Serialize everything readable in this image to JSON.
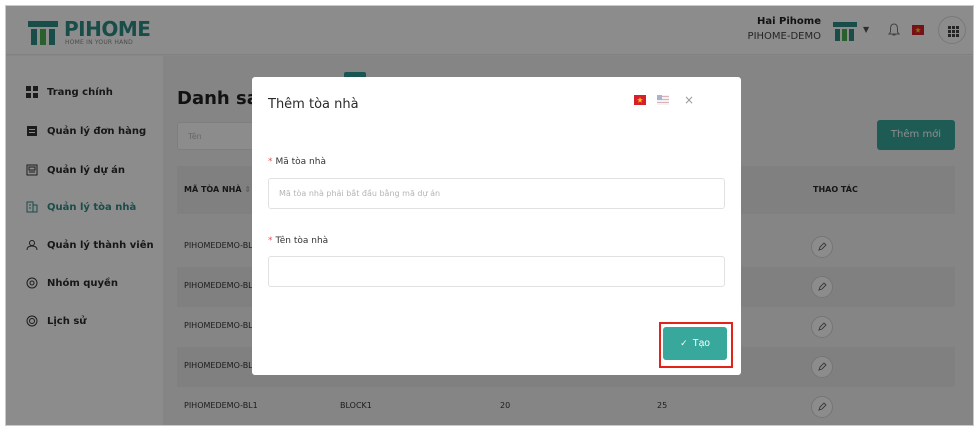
{
  "brand": {
    "name": "PIHOME",
    "tagline": "HOME IN YOUR HAND",
    "color": "#2e8c85"
  },
  "header": {
    "user_name": "Hai Pihome",
    "organization": "PIHOME-DEMO"
  },
  "sidebar": {
    "items": [
      {
        "label": "Trang chính",
        "icon": "dashboard-icon"
      },
      {
        "label": "Quản lý đơn hàng",
        "icon": "orders-icon"
      },
      {
        "label": "Quản lý dự án",
        "icon": "project-icon"
      },
      {
        "label": "Quản lý tòa nhà",
        "icon": "building-icon",
        "active": true
      },
      {
        "label": "Quản lý thành viên",
        "icon": "user-icon"
      },
      {
        "label": "Nhóm quyền",
        "icon": "permission-group-icon"
      },
      {
        "label": "Lịch sử",
        "icon": "history-icon"
      }
    ]
  },
  "page": {
    "title": "Danh sác",
    "search_placeholder": "Tên",
    "add_button": "Thêm mới"
  },
  "table": {
    "columns": {
      "code": "MÃ TÒA NHÀ",
      "actions": "THAO TÁC"
    },
    "rows": [
      {
        "code": "PIHOMEDEMO-BL",
        "name": "",
        "floors": "",
        "units": ""
      },
      {
        "code": "PIHOMEDEMO-BL",
        "name": "",
        "floors": "",
        "units": ""
      },
      {
        "code": "PIHOMEDEMO-BL",
        "name": "",
        "floors": "",
        "units": ""
      },
      {
        "code": "PIHOMEDEMO-BL",
        "name": "",
        "floors": "",
        "units": ""
      },
      {
        "code": "PIHOMEDEMO-BL1",
        "name": "BLOCK1",
        "floors": "20",
        "units": "25"
      }
    ]
  },
  "modal": {
    "title": "Thêm tòa nhà",
    "close_symbol": "×",
    "code_field": {
      "label": "Mã tòa nhà",
      "placeholder": "Mã tòa nhà phải bắt đầu bằng mã dự án",
      "value": ""
    },
    "name_field": {
      "label": "Tên tòa nhà",
      "placeholder": "",
      "value": ""
    },
    "required_mark": "*",
    "submit_label": "Tạo",
    "submit_check": "✓"
  },
  "colors": {
    "accent": "#38a79c",
    "highlight": "#e2231a"
  }
}
